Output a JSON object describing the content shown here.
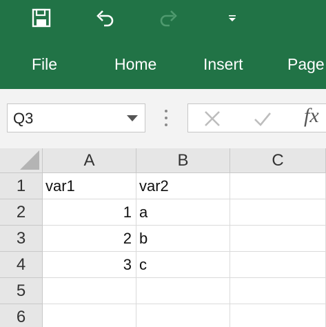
{
  "quick_access": {
    "save_icon": "save-icon",
    "undo_icon": "undo-icon",
    "redo_icon": "redo-icon",
    "customize_icon": "customize-qat-icon"
  },
  "ribbon": {
    "color": "#217346",
    "tabs": [
      {
        "label": "File"
      },
      {
        "label": "Home"
      },
      {
        "label": "Insert"
      },
      {
        "label": "Page"
      }
    ]
  },
  "formula_bar": {
    "name_box": "Q3",
    "cancel_icon": "cancel-icon",
    "enter_icon": "check-icon",
    "function_label": "fx",
    "formula": ""
  },
  "sheet": {
    "columns": [
      "A",
      "B",
      "C"
    ],
    "rows": [
      {
        "number": "1",
        "cells": [
          "var1",
          "var2",
          ""
        ]
      },
      {
        "number": "2",
        "cells": [
          "1",
          "a",
          ""
        ]
      },
      {
        "number": "3",
        "cells": [
          "2",
          "b",
          ""
        ]
      },
      {
        "number": "4",
        "cells": [
          "3",
          "c",
          ""
        ]
      },
      {
        "number": "5",
        "cells": [
          "",
          "",
          ""
        ]
      },
      {
        "number": "6",
        "cells": [
          "",
          "",
          ""
        ]
      }
    ]
  }
}
